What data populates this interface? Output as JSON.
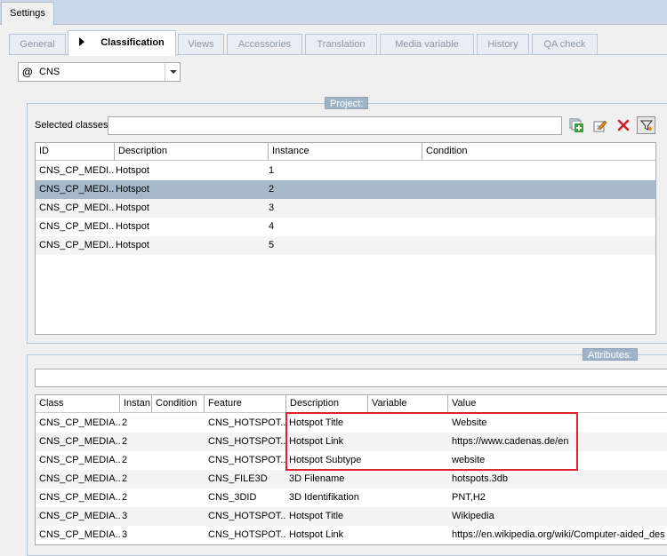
{
  "window_tab": "Settings",
  "tabs": [
    {
      "label": "General"
    },
    {
      "label": "Classification"
    },
    {
      "label": "Views"
    },
    {
      "label": "Accessories"
    },
    {
      "label": "Translation"
    },
    {
      "label": "Media variable"
    },
    {
      "label": "History"
    },
    {
      "label": "QA check"
    }
  ],
  "dropdown": {
    "prefix": "@",
    "value": "CNS"
  },
  "project": {
    "title": "Project:",
    "selected_label": "Selected classes",
    "selected_value": "",
    "icons": [
      "add-class-icon",
      "edit-icon",
      "delete-icon",
      "filter-icon"
    ],
    "columns": [
      "ID",
      "Description",
      "Instance",
      "Condition"
    ],
    "rows": [
      [
        "CNS_CP_MEDI...",
        "Hotspot",
        "1",
        ""
      ],
      [
        "CNS_CP_MEDI...",
        "Hotspot",
        "2",
        ""
      ],
      [
        "CNS_CP_MEDI...",
        "Hotspot",
        "3",
        ""
      ],
      [
        "CNS_CP_MEDI...",
        "Hotspot",
        "4",
        ""
      ],
      [
        "CNS_CP_MEDI...",
        "Hotspot",
        "5",
        ""
      ]
    ]
  },
  "attributes": {
    "title": "Attributes:",
    "filter_value": "",
    "columns": [
      "Class",
      "Instan",
      "Condition",
      "Feature",
      "Description",
      "Variable",
      "Value"
    ],
    "rows": [
      [
        "CNS_CP_MEDIA...",
        "2",
        "",
        "CNS_HOTSPOT...",
        "Hotspot Title",
        "",
        "Website"
      ],
      [
        "CNS_CP_MEDIA...",
        "2",
        "",
        "CNS_HOTSPOT...",
        "Hotspot Link",
        "",
        "https://www.cadenas.de/en"
      ],
      [
        "CNS_CP_MEDIA...",
        "2",
        "",
        "CNS_HOTSPOT...",
        "Hotspot Subtype",
        "",
        "website"
      ],
      [
        "CNS_CP_MEDIA...",
        "2",
        "",
        "CNS_FILE3D",
        "3D Filename",
        "",
        "hotspots.3db"
      ],
      [
        "CNS_CP_MEDIA...",
        "2",
        "",
        "CNS_3DID",
        "3D Identifikation",
        "",
        "PNT,H2"
      ],
      [
        "CNS_CP_MEDIA...",
        "3",
        "",
        "CNS_HOTSPOT...",
        "Hotspot Title",
        "",
        "Wikipedia"
      ],
      [
        "CNS_CP_MEDIA...",
        "3",
        "",
        "CNS_HOTSPOT...",
        "Hotspot Link",
        "",
        "https://en.wikipedia.org/wiki/Computer-aided_des"
      ]
    ]
  },
  "colors": {
    "selected_row": "#a5b9ca",
    "highlight": "#e0202a",
    "group_title": "#9fb3c8"
  }
}
